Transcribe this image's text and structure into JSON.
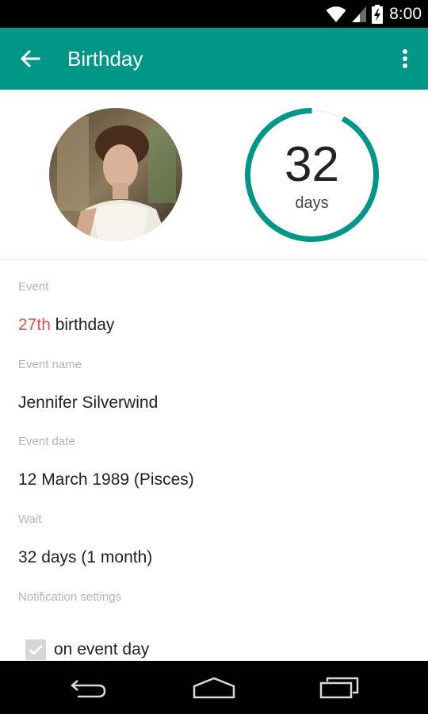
{
  "status_bar": {
    "time": "8:00",
    "icons": [
      "wifi-icon",
      "cell-signal-icon",
      "battery-charging-icon"
    ]
  },
  "app_bar": {
    "title": "Birthday",
    "back_icon": "arrow-left-icon",
    "overflow_icon": "more-vert-icon",
    "color": "#009688"
  },
  "countdown": {
    "number": "32",
    "unit": "days",
    "ring_color": "#009688",
    "progress_fraction": 0.92
  },
  "fields": {
    "event": {
      "label": "Event",
      "ordinal": "27th",
      "text": " birthday",
      "ordinal_color": "#e5534b"
    },
    "event_name": {
      "label": "Event name",
      "value": "Jennifer Silverwind"
    },
    "event_date": {
      "label": "Event date",
      "value": "12 March 1989 (Pisces)"
    },
    "wait": {
      "label": "Wait",
      "value": "32 days (1 month)"
    },
    "notification": {
      "label": "Notification settings"
    }
  },
  "notification_options": [
    {
      "label": "on event day",
      "checked": true
    }
  ],
  "nav_bar": {
    "icons": [
      "nav-back-icon",
      "nav-home-icon",
      "nav-recents-icon"
    ]
  }
}
